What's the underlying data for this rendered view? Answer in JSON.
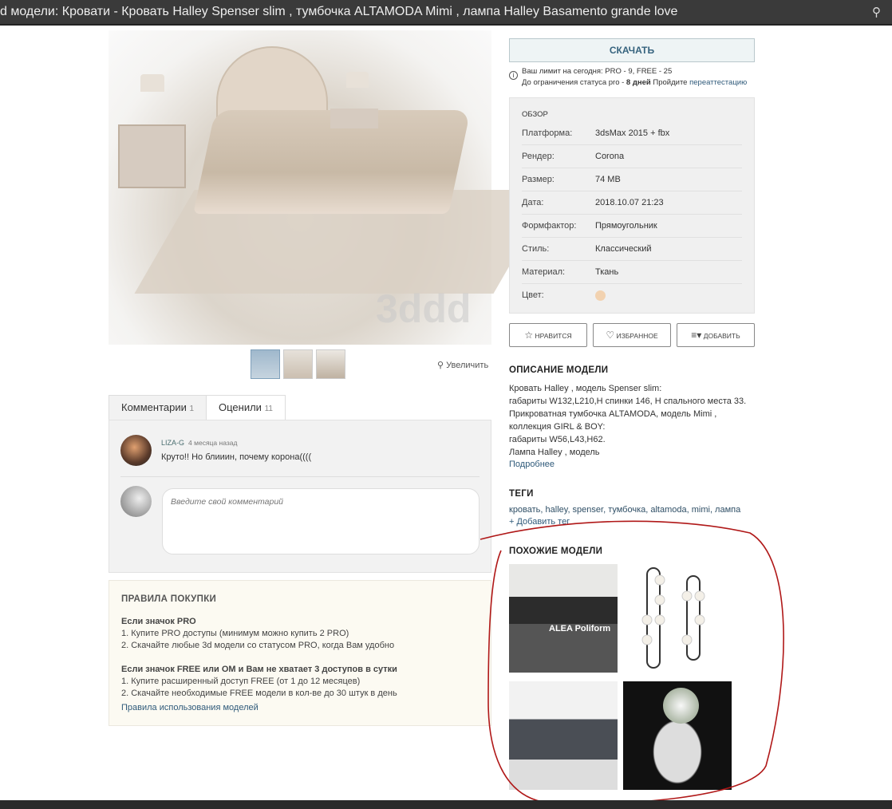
{
  "window": {
    "title": "d модели: Кровати - Кровать Halley Spenser slim , тумбочка ALTAMODA Mimi , лампа Halley Basamento grande love"
  },
  "gallery": {
    "watermark": "3ddd",
    "zoom_label": "Увеличить",
    "thumbnails": 3
  },
  "tabs": [
    {
      "label": "Комментарии",
      "count": "1"
    },
    {
      "label": "Оценили",
      "count": "11"
    }
  ],
  "comments": [
    {
      "author": "LIZA-G",
      "time": "4 месяца назад",
      "text": "Круто!! Но блииин, почему корона(((("
    }
  ],
  "comment_input": {
    "placeholder": "Введите свой комментарий"
  },
  "rules": {
    "title": "ПРАВИЛА ПОКУПКИ",
    "pro_title": "Если значок PRO",
    "pro_1": "1. Купите PRO доступы (минимум можно купить 2 PRO)",
    "pro_2": "2. Скачайте любые 3d модели со статусом PRO, когда Вам удобно",
    "free_title": "Если значок FREE или OM и Вам не хватает 3 доступов в сутки",
    "free_1": "1. Купите расширенный доступ FREE (от 1 до 12 месяцев)",
    "free_2": "2. Скачайте необходимые FREE модели в кол-ве до 30 штук в день",
    "link": "Правила использования моделей"
  },
  "download": {
    "label": "СКАЧАТЬ",
    "limit_line": "Ваш лимит на сегодня: PRO - 9, FREE - 25",
    "status_prefix": "До ограничения статуса pro - ",
    "status_days": "8 дней",
    "status_suffix": " Пройдите ",
    "status_link": "переаттестацию"
  },
  "overview": {
    "title": "ОБЗОР",
    "rows": [
      {
        "k": "Платформа:",
        "v": "3dsMax 2015 + fbx"
      },
      {
        "k": "Рендер:",
        "v": "Corona"
      },
      {
        "k": "Размер:",
        "v": "74 MB"
      },
      {
        "k": "Дата:",
        "v": "2018.10.07 21:23"
      },
      {
        "k": "Формфактор:",
        "v": "Прямоугольник"
      },
      {
        "k": "Стиль:",
        "v": "Классический"
      },
      {
        "k": "Материал:",
        "v": "Ткань"
      },
      {
        "k": "Цвет:",
        "v": ""
      }
    ],
    "color_swatch": "#f2d2b0"
  },
  "actions": {
    "like": "НРАВИТСЯ",
    "favorite": "ИЗБРАННОЕ",
    "add": "ДОБАВИТЬ"
  },
  "description": {
    "title": "ОПИСАНИЕ МОДЕЛИ",
    "lines": [
      "Кровать Halley , модель Spenser slim:",
      "габариты W132,L210,H спинки 146, H спального места 33.",
      "Прикроватная тумбочка ALTAMODA,  модель Mimi ,",
      "коллекция GIRL & BOY:",
      "габариты W56,L43,H62.",
      "Лампа Halley , модель"
    ],
    "more": "Подробнее"
  },
  "tags": {
    "title": "ТЕГИ",
    "list": "кровать, halley, spenser, тумбочка, altamoda, mimi, лампа",
    "add": "+ Добавить тег"
  },
  "similar": {
    "title": "ПОХОЖИЕ МОДЕЛИ",
    "brand_label": "ALEA Poliform"
  }
}
